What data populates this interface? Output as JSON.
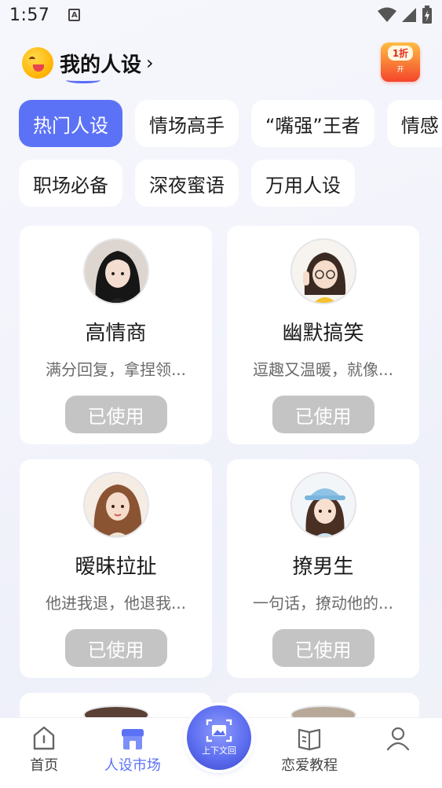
{
  "status_bar": {
    "time": "1:57",
    "app_icon": "A"
  },
  "header": {
    "title": "我的人设",
    "chevron": "›",
    "badge_main": "1折",
    "badge_sub": "开"
  },
  "tabs": {
    "row1": [
      {
        "label": "热门人设",
        "active": true
      },
      {
        "label": "情场高手",
        "active": false
      },
      {
        "label": "“嘴强”王者",
        "active": false
      },
      {
        "label": "情感",
        "active": false
      }
    ],
    "row2": [
      {
        "label": "职场必备",
        "active": false
      },
      {
        "label": "深夜蜜语",
        "active": false
      },
      {
        "label": "万用人设",
        "active": false
      }
    ]
  },
  "cards": [
    {
      "title": "高情商",
      "desc": "满分回复，拿捏领...",
      "button": "已使用",
      "avatar": "avatar-dark-hair-girl"
    },
    {
      "title": "幽默搞笑",
      "desc": "逗趣又温暖，就像...",
      "button": "已使用",
      "avatar": "avatar-glasses-girl"
    },
    {
      "title": "暧昧拉扯",
      "desc": "他进我退，他退我...",
      "button": "已使用",
      "avatar": "avatar-curly-hair-girl"
    },
    {
      "title": "撩男生",
      "desc": "一句话，撩动他的...",
      "button": "已使用",
      "avatar": "avatar-cap-girl"
    }
  ],
  "bottom_nav": [
    {
      "label": "首页",
      "icon": "home-icon",
      "active": false
    },
    {
      "label": "人设市场",
      "icon": "store-icon",
      "active": true
    },
    {
      "label": "上下文回",
      "icon": "image-scan-icon",
      "active": false
    },
    {
      "label": "恋爱教程",
      "icon": "book-icon",
      "active": false
    },
    {
      "label": "",
      "icon": "user-icon",
      "active": false
    }
  ],
  "colors": {
    "accent": "#5c72f6",
    "disabled_button": "#c4c4c4",
    "badge_red": "#f4452c"
  }
}
